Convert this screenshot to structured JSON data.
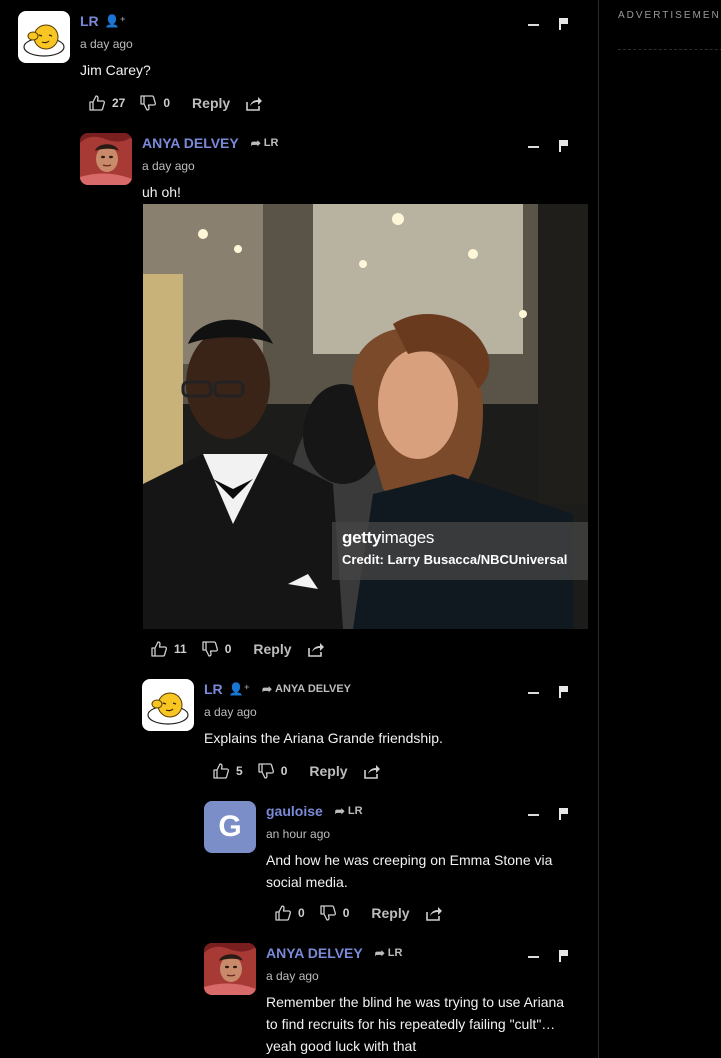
{
  "sidebar": {
    "ad_label": "ADVERTISEMENT"
  },
  "comments": [
    {
      "author": "LR",
      "time": "a day ago",
      "text": "Jim Carey?",
      "upvotes": "27",
      "downvotes": "0",
      "reply_label": "Reply",
      "avatar": "egg-avatar"
    },
    {
      "author": "ANYA DELVEY",
      "reply_to": "LR",
      "time": "a day ago",
      "text": "uh oh!",
      "upvotes": "11",
      "downvotes": "0",
      "reply_label": "Reply",
      "avatar": "photo-avatar",
      "image": {
        "brand_bold": "getty",
        "brand_rest": "images",
        "credit": "Credit: Larry Busacca/NBCUniversal"
      }
    },
    {
      "author": "LR",
      "reply_to": "ANYA DELVEY",
      "time": "a day ago",
      "text": "Explains the Ariana Grande friendship.",
      "upvotes": "5",
      "downvotes": "0",
      "reply_label": "Reply",
      "avatar": "egg-avatar"
    },
    {
      "author": "gauloise",
      "reply_to": "LR",
      "time": "an hour ago",
      "text_lines": [
        "And how he was creeping on Emma Stone via",
        "social media."
      ],
      "upvotes": "0",
      "downvotes": "0",
      "reply_label": "Reply",
      "avatar_letter": "G"
    },
    {
      "author": "ANYA DELVEY",
      "reply_to": "LR",
      "time": "a day ago",
      "text_lines": [
        "Remember the blind he was trying to use Ariana",
        "to find recruits for his repeatedly failing \"cult\"…",
        "yeah good luck with that"
      ],
      "avatar": "photo-avatar"
    }
  ]
}
